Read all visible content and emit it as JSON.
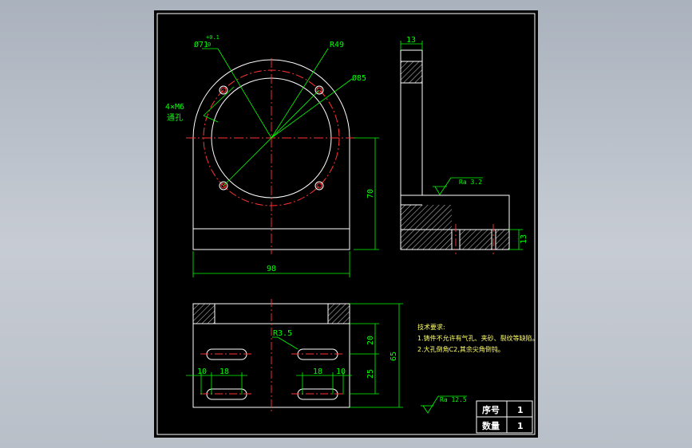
{
  "drawing": {
    "dims": {
      "bore": "Ø71",
      "tol_upper": "+0.1",
      "tol_lower": "0",
      "r49": "R49",
      "d85": "Ø85",
      "holes_qty": "4×M6",
      "holes_type": "通孔",
      "width_98": "98",
      "height_70": "70",
      "thick_top": "13",
      "thick_side": "13",
      "slot_r": "R3.5",
      "d20": "20",
      "d25": "25",
      "d65": "65",
      "d10a": "10",
      "d18a": "18",
      "d18b": "18",
      "d10b": "10"
    },
    "roughness": {
      "local": "Ra 3.2",
      "general": "Ra 12.5"
    },
    "tech_notes": {
      "title": "技术要求:",
      "line1": "1.铸件不允许有气孔、夹砂、裂纹等缺陷。",
      "line2": "2.大孔倒角C2,其余尖角倒钝。"
    },
    "title_block": {
      "seq_label": "序号",
      "seq_value": "1",
      "qty_label": "数量",
      "qty_value": "1"
    },
    "colors": {
      "outline": "#ffffff",
      "dimension": "#00ff00",
      "centerline": "#ff3333",
      "annotation": "#ffff66"
    }
  }
}
